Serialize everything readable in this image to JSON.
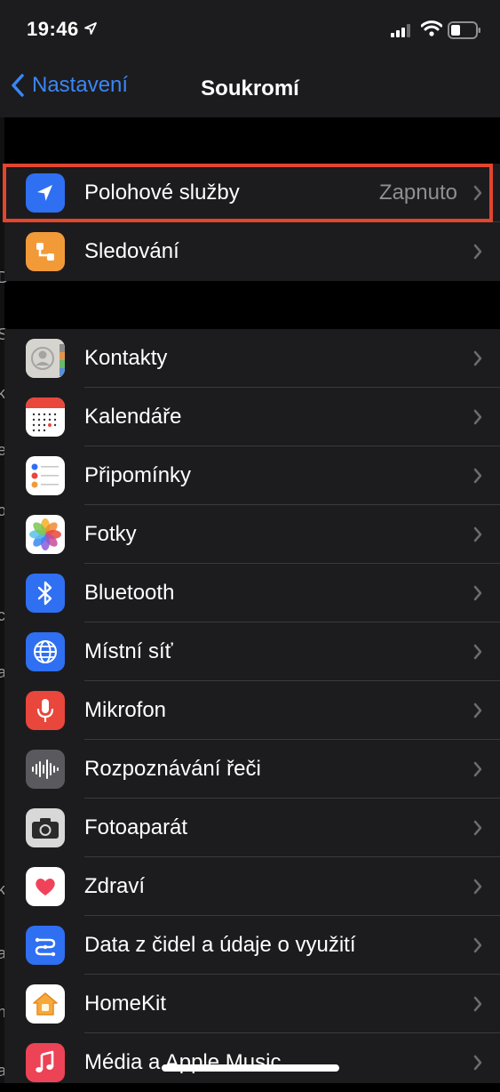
{
  "status": {
    "time": "19:46"
  },
  "nav": {
    "back_label": "Nastavení",
    "title": "Soukromí"
  },
  "group1": [
    {
      "label": "Polohové služby",
      "value": "Zapnuto",
      "icon": "location-arrow-icon",
      "color": "#2f6ff2"
    },
    {
      "label": "Sledování",
      "value": "",
      "icon": "tracking-icon",
      "color": "#f29a38"
    }
  ],
  "group2": [
    {
      "label": "Kontakty",
      "icon": "contacts-icon"
    },
    {
      "label": "Kalendáře",
      "icon": "calendar-icon"
    },
    {
      "label": "Připomínky",
      "icon": "reminders-icon"
    },
    {
      "label": "Fotky",
      "icon": "photos-icon"
    },
    {
      "label": "Bluetooth",
      "icon": "bluetooth-icon",
      "color": "#2f6ff2"
    },
    {
      "label": "Místní síť",
      "icon": "globe-icon",
      "color": "#2f6ff2"
    },
    {
      "label": "Mikrofon",
      "icon": "microphone-icon",
      "color": "#e9463c"
    },
    {
      "label": "Rozpoznávání řeči",
      "icon": "waveform-icon",
      "color": "#5a5a5e"
    },
    {
      "label": "Fotoaparát",
      "icon": "camera-icon",
      "color": "#d8d8d8"
    },
    {
      "label": "Zdraví",
      "icon": "heart-icon",
      "color": "#ffffff"
    },
    {
      "label": "Data z čidel a údaje o využití",
      "icon": "sensor-data-icon",
      "color": "#2f6ff2"
    },
    {
      "label": "HomeKit",
      "icon": "home-icon",
      "color": "#ffffff"
    },
    {
      "label": "Média a Apple Music",
      "icon": "music-note-icon",
      "color": "#ec4356"
    }
  ],
  "left_edge_chars": [
    "D",
    "S",
    "k",
    "e",
    "o",
    "c",
    "a",
    "k",
    "a",
    "h",
    "a"
  ]
}
